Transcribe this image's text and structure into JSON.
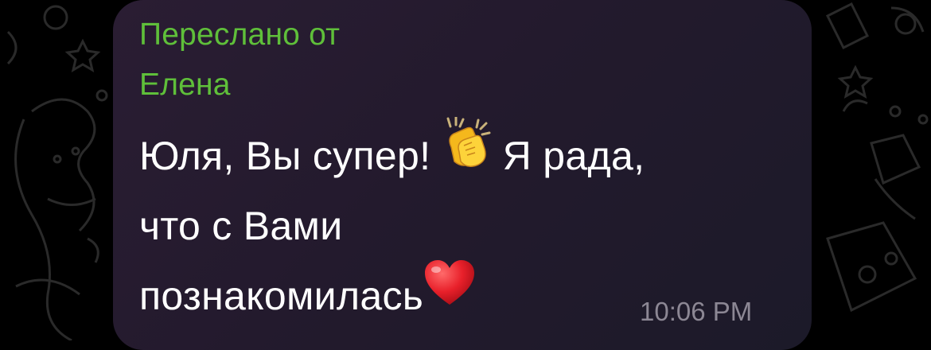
{
  "message": {
    "forwarded_label": "Переслано от",
    "forwarded_from": "Елена",
    "text_line_1_a": "Юля, Вы супер!",
    "text_line_1_b": "Я рада,",
    "text_line_2": "что с Вами",
    "text_line_3": "познакомилась",
    "time": "10:06 PM",
    "emoji_1": "clapping-hands-icon",
    "emoji_2": "red-heart-icon"
  },
  "colors": {
    "background": "#000000",
    "bubble": "#251b2f",
    "forward_header": "#5fbf3a",
    "text": "#ffffff",
    "timestamp": "#8c8794"
  }
}
